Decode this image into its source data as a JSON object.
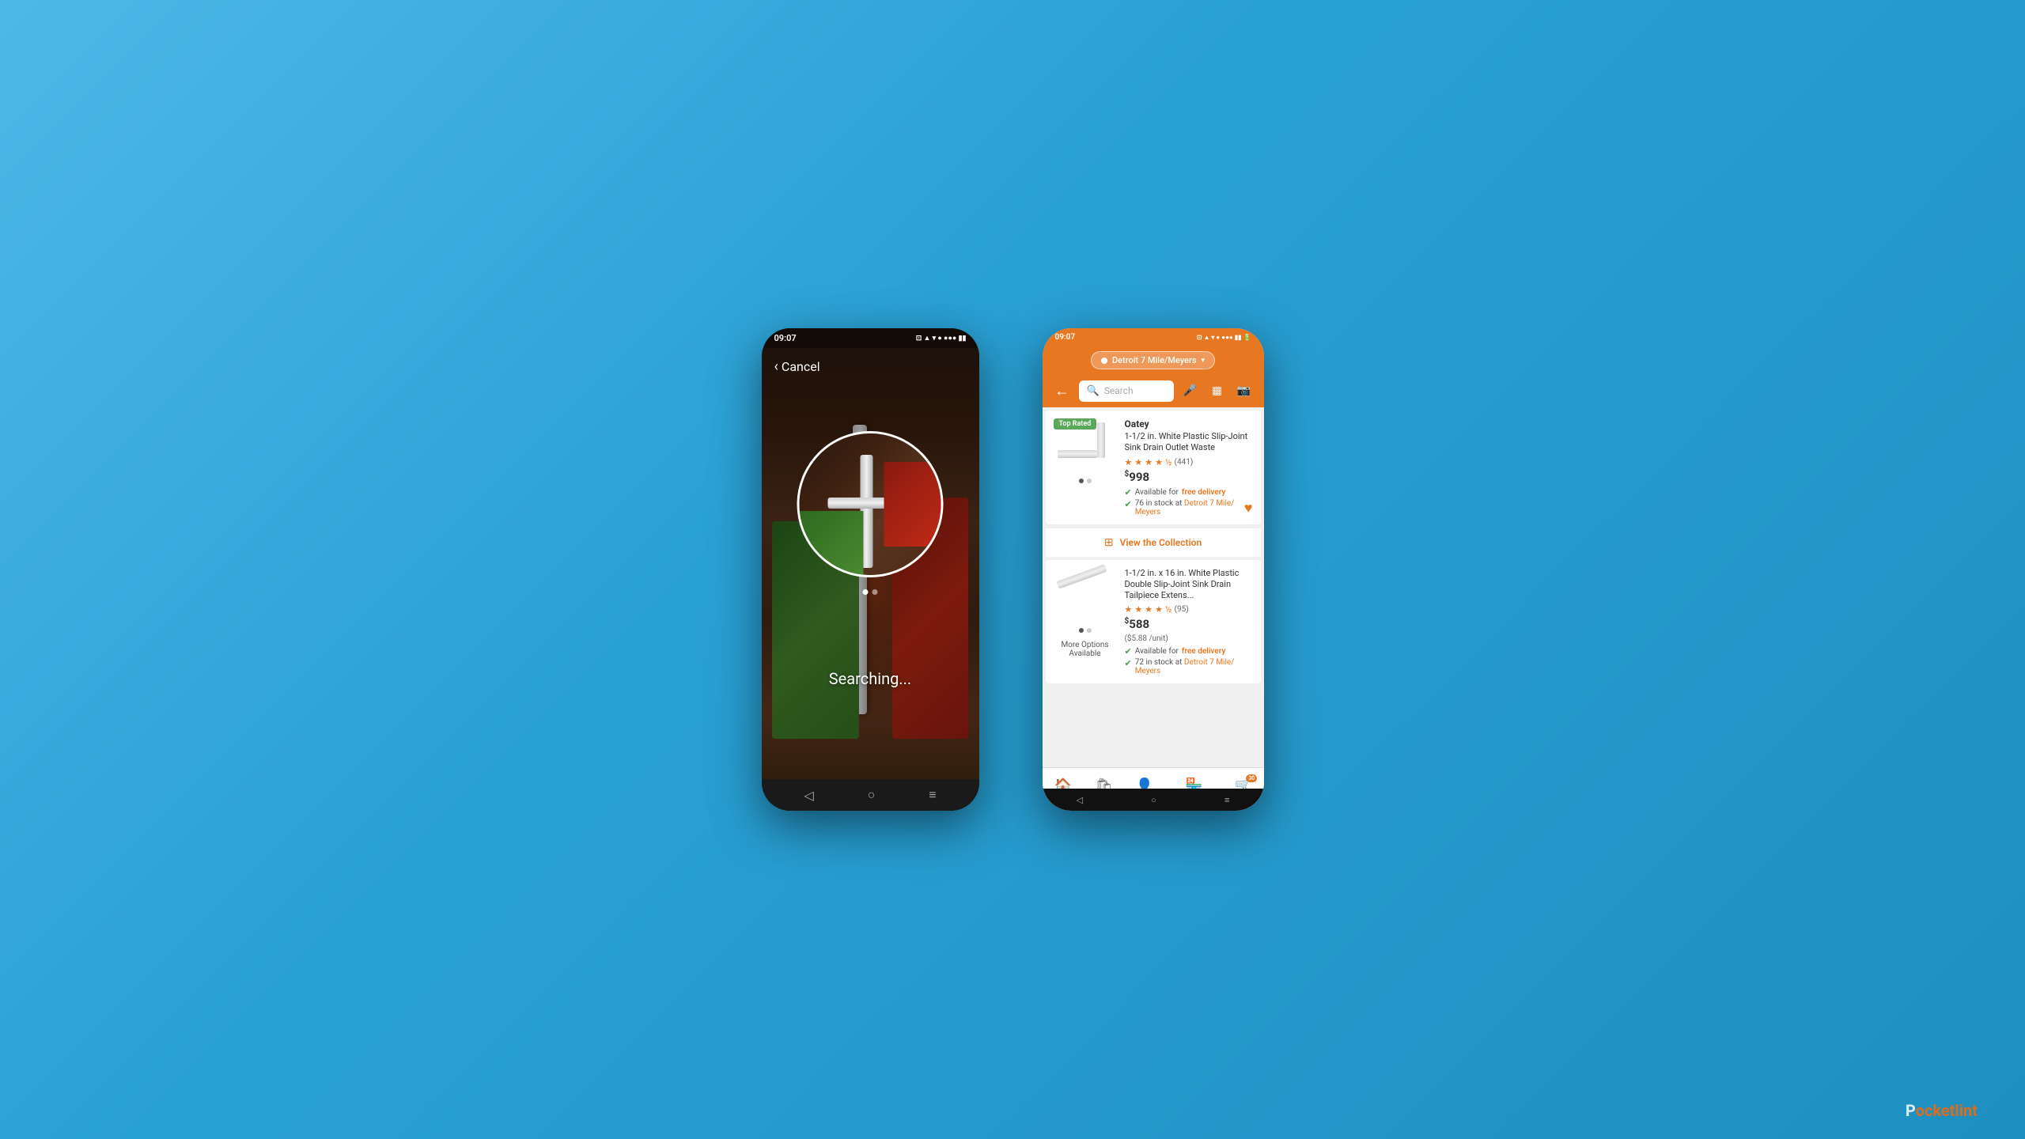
{
  "background": {
    "color": "#4db8e8"
  },
  "left_phone": {
    "status_bar": {
      "time": "09:07",
      "icons": "📶"
    },
    "cancel_button": "Cancel",
    "searching_text": "Searching...",
    "nav": {
      "back": "◁",
      "home": "○",
      "menu": "≡"
    }
  },
  "right_phone": {
    "status_bar": {
      "time": "09:07"
    },
    "location": {
      "label": "Detroit 7 Mile/Meyers"
    },
    "search": {
      "placeholder": "Search"
    },
    "top_rated_badge": "Top Rated",
    "product1": {
      "brand": "Oatey",
      "title": "1-1/2 in. White Plastic Slip-Joint Sink Drain Outlet Waste",
      "rating": "4.5",
      "review_count": "(441)",
      "price": "9",
      "price_cents": "98",
      "delivery_text": "Available for",
      "delivery_link": "free delivery",
      "stock_count": "76",
      "stock_text": "in stock at",
      "store_name": "Detroit 7 Mile/ Meyers"
    },
    "collection_link": "View the Collection",
    "product2": {
      "title": "1-1/2 in. x 16 in. White Plastic Double Slip-Joint Sink Drain Tailpiece Extens...",
      "rating": "4.5",
      "review_count": "(95)",
      "price": "5",
      "price_cents": "88",
      "unit_price": "($5.88 /unit)",
      "delivery_text": "Available for",
      "delivery_link": "free delivery",
      "stock_count": "72",
      "stock_text": "in stock at",
      "store_name": "Detroit 7 Mile/ Meyers",
      "more_options": "More Options Available"
    },
    "bottom_nav": {
      "home": "Home",
      "shop": "Shop",
      "me": "Me",
      "store_mode": "Store Mode",
      "cart": "Cart",
      "cart_count": "30"
    }
  },
  "watermark": {
    "text_before": "P",
    "highlight": "o",
    "text_after": "cketlint"
  }
}
